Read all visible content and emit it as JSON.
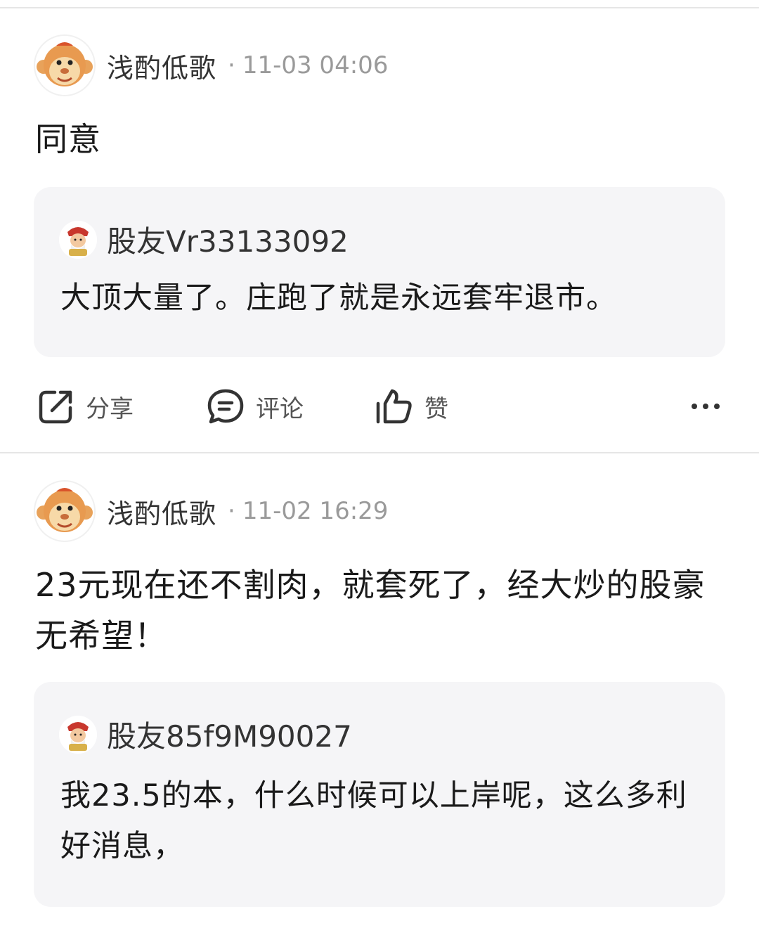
{
  "posts": [
    {
      "username": "浅酌低歌",
      "separator": "·",
      "time": "11-03 04:06",
      "content": "同意",
      "quote": {
        "username": "股友Vr33133092",
        "text": "大顶大量了。庄跑了就是永远套牢退市。"
      }
    },
    {
      "username": "浅酌低歌",
      "separator": "·",
      "time": "11-02 16:29",
      "content": "23元现在还不割肉，就套死了，经大炒的股豪无希望！",
      "quote": {
        "username": "股友85f9M90027",
        "text": "我23.5的本，什么时候可以上岸呢，这么多利好消息，"
      }
    }
  ],
  "actions": {
    "share_label": "分享",
    "comment_label": "评论",
    "like_label": "赞"
  },
  "icons": {
    "share": "share-icon",
    "comment": "comment-icon",
    "like": "thumbs-up-icon",
    "more": "more-icon"
  },
  "colors": {
    "quote_bg": "#f5f5f7",
    "meta_text": "#9a9a9a",
    "divider": "#e6e6e6"
  }
}
